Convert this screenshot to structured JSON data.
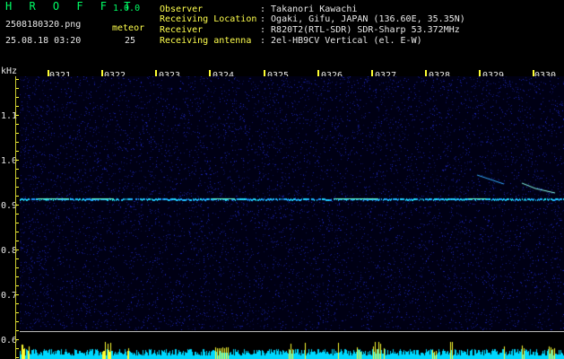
{
  "header": {
    "app_name": "H R O F F T",
    "version": "1.0.0",
    "filename": "2508180320.png",
    "datetime": "25.08.18 03:20",
    "meteor_label": "meteor",
    "meteor_count": "25"
  },
  "info": {
    "rows": [
      {
        "label": "Observer",
        "value": ": Takanori Kawachi"
      },
      {
        "label": "Receiving Location",
        "value": ": Ogaki, Gifu, JAPAN (136.60E, 35.35N)"
      },
      {
        "label": "Receiver",
        "value": ": R820T2(RTL-SDR) SDR-Sharp 53.372MHz"
      },
      {
        "label": "Receiving antenna",
        "value": ": 2el-HB9CV Vertical (el. E-W)"
      }
    ]
  },
  "axes": {
    "y_unit": "kHz",
    "x_ticks": [
      "0321",
      "0322",
      "0323",
      "0324",
      "0325",
      "0326",
      "0327",
      "0328",
      "0329",
      "0330"
    ],
    "y_ticks": [
      "1.1",
      "1.0",
      "0.9",
      "0.8",
      "0.7",
      "0.6"
    ]
  },
  "colors": {
    "background": "#000000",
    "noise_blue": "#1a2a9a",
    "signal_cyan": "#33ccff",
    "signal_green": "#66ffcc",
    "strip_cyan": "#00d8ff",
    "strip_yellow": "#ffff33"
  }
}
